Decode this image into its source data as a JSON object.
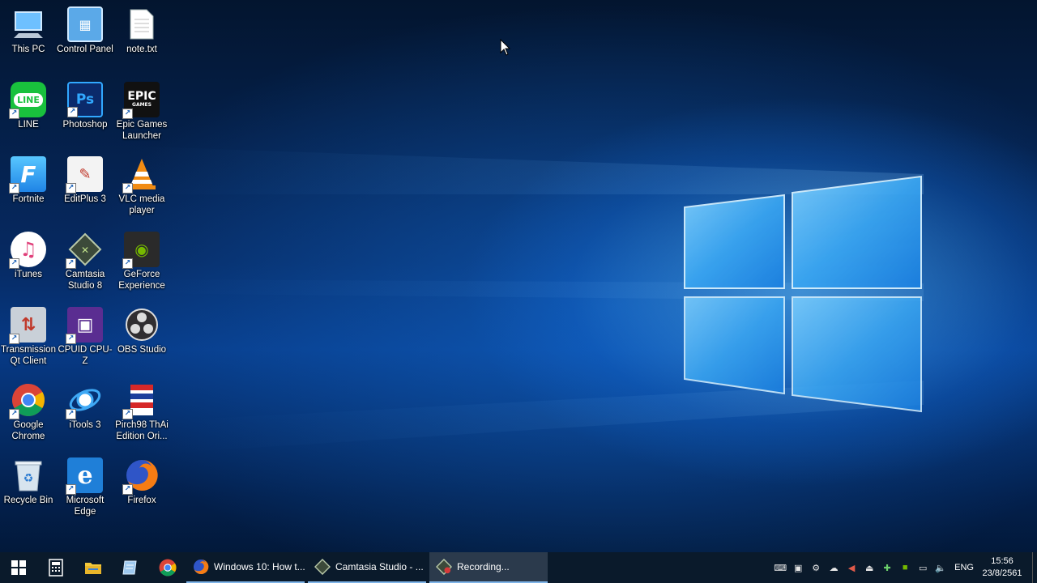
{
  "desktop": {
    "icons": [
      {
        "label": "This PC",
        "icon": "computer-icon"
      },
      {
        "label": "Control Panel",
        "icon": "control-panel-icon"
      },
      {
        "label": "note.txt",
        "icon": "text-file-icon"
      },
      {
        "label": "LINE",
        "icon": "line-icon"
      },
      {
        "label": "Photoshop",
        "icon": "photoshop-icon"
      },
      {
        "label": "Epic Games Launcher",
        "icon": "epic-games-icon"
      },
      {
        "label": "Fortnite",
        "icon": "fortnite-icon"
      },
      {
        "label": "EditPlus 3",
        "icon": "editplus-icon"
      },
      {
        "label": "VLC media player",
        "icon": "vlc-icon"
      },
      {
        "label": "iTunes",
        "icon": "itunes-icon"
      },
      {
        "label": "Camtasia Studio 8",
        "icon": "camtasia-icon"
      },
      {
        "label": "GeForce Experience",
        "icon": "geforce-icon"
      },
      {
        "label": "Transmission Qt Client",
        "icon": "transmission-icon"
      },
      {
        "label": "CPUID CPU-Z",
        "icon": "cpuz-icon"
      },
      {
        "label": "OBS Studio",
        "icon": "obs-icon"
      },
      {
        "label": "Google Chrome",
        "icon": "chrome-icon"
      },
      {
        "label": "iTools 3",
        "icon": "itools-icon"
      },
      {
        "label": "Pirch98 ThAi Edition Ori...",
        "icon": "pirch-icon"
      },
      {
        "label": "Recycle Bin",
        "icon": "recycle-bin-icon"
      },
      {
        "label": "Microsoft Edge",
        "icon": "edge-icon"
      },
      {
        "label": "Firefox",
        "icon": "firefox-icon"
      }
    ]
  },
  "taskbar": {
    "tasks": [
      {
        "label": "Windows 10: How t...",
        "icon": "firefox-icon"
      },
      {
        "label": "Camtasia Studio - ...",
        "icon": "camtasia-icon"
      },
      {
        "label": "Recording...",
        "icon": "recording-icon"
      }
    ],
    "tray": {
      "language": "ENG",
      "time": "15:56",
      "date": "23/8/2561"
    }
  },
  "colors": {
    "accent": "#7fb4e8",
    "taskbar": "#0a1a2b",
    "wallpaper_glow": "#5ab8ff"
  }
}
